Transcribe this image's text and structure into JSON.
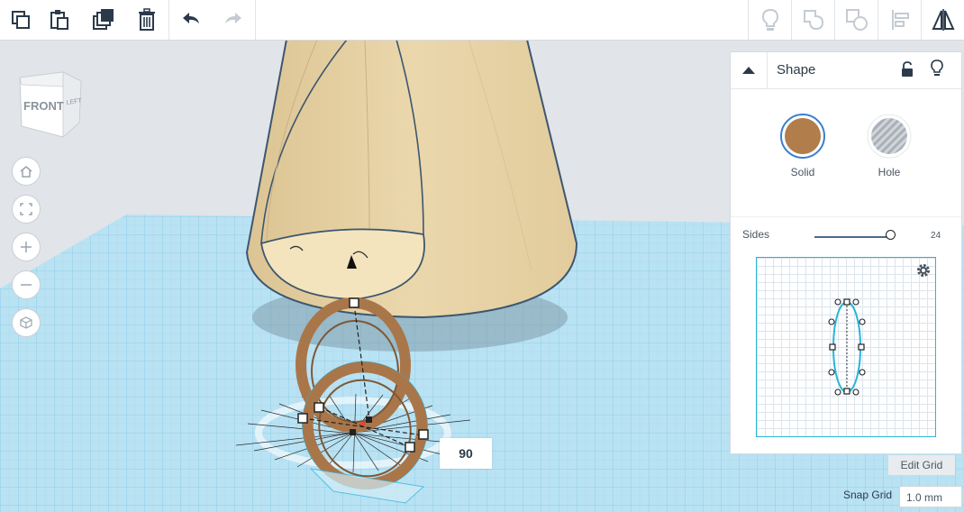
{
  "toolbar": {
    "left": [
      {
        "name": "copy-button",
        "icon": "copy-icon"
      },
      {
        "name": "paste-button",
        "icon": "paste-icon"
      },
      {
        "name": "duplicate-button",
        "icon": "duplicate-icon"
      },
      {
        "name": "delete-button",
        "icon": "trash-icon"
      },
      {
        "name": "undo-button",
        "icon": "undo-icon"
      },
      {
        "name": "redo-button",
        "icon": "redo-icon"
      }
    ],
    "right": [
      {
        "name": "show-all-button",
        "icon": "lightbulb-icon"
      },
      {
        "name": "group-button",
        "icon": "group-icon"
      },
      {
        "name": "ungroup-button",
        "icon": "ungroup-icon"
      },
      {
        "name": "align-button",
        "icon": "align-icon"
      },
      {
        "name": "mirror-button",
        "icon": "mirror-icon"
      }
    ]
  },
  "viewcube": {
    "front_label": "FRONT",
    "side_label": "LEFT"
  },
  "nav_buttons": [
    {
      "name": "home-view-button",
      "icon": "home-icon"
    },
    {
      "name": "fit-view-button",
      "icon": "fit-icon"
    },
    {
      "name": "zoom-in-button",
      "icon": "plus-icon"
    },
    {
      "name": "zoom-out-button",
      "icon": "minus-icon"
    },
    {
      "name": "perspective-button",
      "icon": "cube-icon"
    }
  ],
  "inspector": {
    "title": "Shape",
    "solid_label": "Solid",
    "hole_label": "Hole",
    "solid_color": "#b07d4b",
    "sides_label": "Sides",
    "sides_value": "24"
  },
  "grid": {
    "edit_label": "Edit Grid",
    "snap_label": "Snap Grid",
    "snap_value": "1.0 mm"
  },
  "angle_readout": "90",
  "colors": {
    "workplane": "#aedcf0",
    "grid_line": "#7fc6e6",
    "cone": "#e9d5a7",
    "ring": "#a9764a",
    "selection": "#29b5d8"
  }
}
